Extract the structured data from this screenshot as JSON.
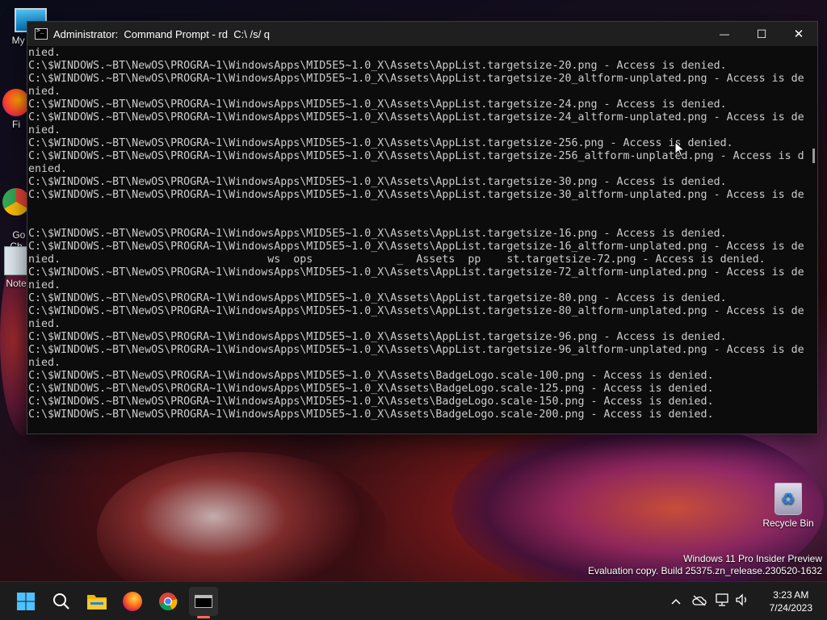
{
  "desktop": {
    "icons": [
      {
        "label": "My Co"
      },
      {
        "label": "Fi"
      },
      {
        "label": "Go\nCh"
      },
      {
        "label": "Note"
      },
      {
        "label": "Recycle Bin"
      }
    ],
    "watermark_line1": "Windows 11 Pro Insider Preview",
    "watermark_line2": "Evaluation copy. Build 25375.zn_release.230520-1632"
  },
  "window": {
    "title": "Administrator:  Command Prompt - rd  C:\\ /s/ q",
    "minimize_glyph": "—",
    "maximize_glyph": "☐",
    "close_glyph": "✕",
    "lines": [
      "nied.",
      "C:\\$WINDOWS.~BT\\NewOS\\PROGRA~1\\WindowsApps\\MID5E5~1.0_X\\Assets\\AppList.targetsize-20.png - Access is denied.",
      "C:\\$WINDOWS.~BT\\NewOS\\PROGRA~1\\WindowsApps\\MID5E5~1.0_X\\Assets\\AppList.targetsize-20_altform-unplated.png - Access is de",
      "nied.",
      "C:\\$WINDOWS.~BT\\NewOS\\PROGRA~1\\WindowsApps\\MID5E5~1.0_X\\Assets\\AppList.targetsize-24.png - Access is denied.",
      "C:\\$WINDOWS.~BT\\NewOS\\PROGRA~1\\WindowsApps\\MID5E5~1.0_X\\Assets\\AppList.targetsize-24_altform-unplated.png - Access is de",
      "nied.",
      "C:\\$WINDOWS.~BT\\NewOS\\PROGRA~1\\WindowsApps\\MID5E5~1.0_X\\Assets\\AppList.targetsize-256.png - Access is denied.",
      "C:\\$WINDOWS.~BT\\NewOS\\PROGRA~1\\WindowsApps\\MID5E5~1.0_X\\Assets\\AppList.targetsize-256_altform-unplated.png - Access is d",
      "enied.",
      "C:\\$WINDOWS.~BT\\NewOS\\PROGRA~1\\WindowsApps\\MID5E5~1.0_X\\Assets\\AppList.targetsize-30.png - Access is denied.",
      "C:\\$WINDOWS.~BT\\NewOS\\PROGRA~1\\WindowsApps\\MID5E5~1.0_X\\Assets\\AppList.targetsize-30_altform-unplated.png - Access is de",
      "",
      "",
      "C:\\$WINDOWS.~BT\\NewOS\\PROGRA~1\\WindowsApps\\MID5E5~1.0_X\\Assets\\AppList.targetsize-16.png - Access is denied.",
      "C:\\$WINDOWS.~BT\\NewOS\\PROGRA~1\\WindowsApps\\MID5E5~1.0_X\\Assets\\AppList.targetsize-16_altform-unplated.png - Access is de",
      "nied.                                ws  ops             _  Assets  pp    st.targetsize-72.png - Access is denied.",
      "C:\\$WINDOWS.~BT\\NewOS\\PROGRA~1\\WindowsApps\\MID5E5~1.0_X\\Assets\\AppList.targetsize-72_altform-unplated.png - Access is de",
      "nied.",
      "C:\\$WINDOWS.~BT\\NewOS\\PROGRA~1\\WindowsApps\\MID5E5~1.0_X\\Assets\\AppList.targetsize-80.png - Access is denied.",
      "C:\\$WINDOWS.~BT\\NewOS\\PROGRA~1\\WindowsApps\\MID5E5~1.0_X\\Assets\\AppList.targetsize-80_altform-unplated.png - Access is de",
      "nied.",
      "C:\\$WINDOWS.~BT\\NewOS\\PROGRA~1\\WindowsApps\\MID5E5~1.0_X\\Assets\\AppList.targetsize-96.png - Access is denied.",
      "C:\\$WINDOWS.~BT\\NewOS\\PROGRA~1\\WindowsApps\\MID5E5~1.0_X\\Assets\\AppList.targetsize-96_altform-unplated.png - Access is de",
      "nied.",
      "C:\\$WINDOWS.~BT\\NewOS\\PROGRA~1\\WindowsApps\\MID5E5~1.0_X\\Assets\\BadgeLogo.scale-100.png - Access is denied.",
      "C:\\$WINDOWS.~BT\\NewOS\\PROGRA~1\\WindowsApps\\MID5E5~1.0_X\\Assets\\BadgeLogo.scale-125.png - Access is denied.",
      "C:\\$WINDOWS.~BT\\NewOS\\PROGRA~1\\WindowsApps\\MID5E5~1.0_X\\Assets\\BadgeLogo.scale-150.png - Access is denied.",
      "C:\\$WINDOWS.~BT\\NewOS\\PROGRA~1\\WindowsApps\\MID5E5~1.0_X\\Assets\\BadgeLogo.scale-200.png - Access is denied."
    ]
  },
  "taskbar": {
    "apps": [
      {
        "name": "start-button",
        "icon": "windows-logo-icon"
      },
      {
        "name": "search-button",
        "icon": "search-icon"
      },
      {
        "name": "file-explorer-button",
        "icon": "folder-icon"
      },
      {
        "name": "firefox-button",
        "icon": "firefox-icon"
      },
      {
        "name": "chrome-button",
        "icon": "chrome-icon"
      },
      {
        "name": "terminal-button",
        "icon": "terminal-icon"
      }
    ],
    "tray_icons": [
      "chevron-up-icon",
      "onedrive-offline-icon",
      "network-icon",
      "volume-icon"
    ],
    "time": "3:23 AM",
    "date": "7/24/2023"
  },
  "colors": {
    "console_bg": "#0c0c0c",
    "console_text": "#cccccc",
    "titlebar_bg": "#1f1f1f",
    "taskbar_bg": "#1c1c1c",
    "accent": "#ff6b5a"
  }
}
